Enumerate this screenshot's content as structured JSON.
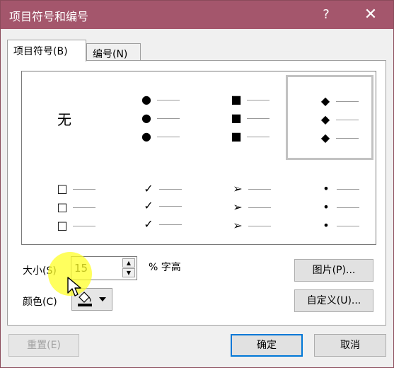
{
  "dialog": {
    "title": "项目符号和编号",
    "help": "?",
    "close": "✕"
  },
  "tabs": [
    {
      "label": "项目符号(B)"
    },
    {
      "label": "编号(N)"
    }
  ],
  "gallery": {
    "none_label": "无",
    "bullet_glyphs": [
      "●",
      "■",
      "◆",
      "□",
      "✓",
      "➢",
      "•"
    ]
  },
  "size": {
    "label": "大小(S)",
    "value": "15",
    "unit": "% 字高"
  },
  "color": {
    "label": "颜色(C)",
    "swatch_color": "#000000"
  },
  "buttons": {
    "picture": "图片(P)...",
    "customize": "自定义(U)...",
    "reset": "重置(E)",
    "ok": "确定",
    "cancel": "取消"
  }
}
